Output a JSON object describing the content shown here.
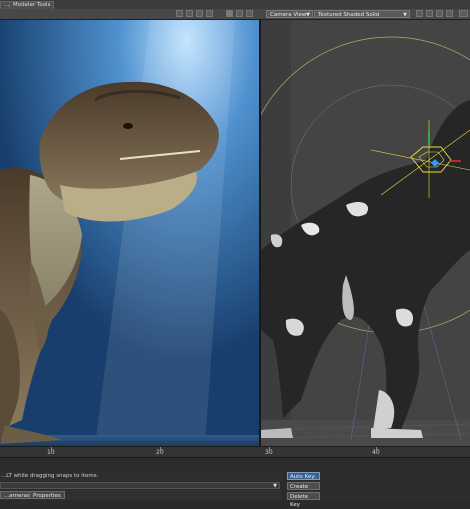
{
  "toolbar": {
    "tabs": [
      "...s",
      "Modeler Tools"
    ]
  },
  "viewport_header": {
    "view_type": "Camera View",
    "render_mode": "Textured Shaded Solid"
  },
  "timeline": {
    "ticks": [
      "10",
      "20",
      "30",
      "40"
    ]
  },
  "status": {
    "message": "...LT while dragging snaps to items."
  },
  "bottom_tabs": [
    "...ameras",
    "Properties"
  ],
  "key_buttons": {
    "auto_key": "Auto Key: ...F1",
    "create_key": "Create Key",
    "delete_key": "Delete Key"
  },
  "colors": {
    "render_bg": "#2f6aa8",
    "workspace_bg": "#3e3e3e",
    "accent": "#3b5f8e"
  }
}
